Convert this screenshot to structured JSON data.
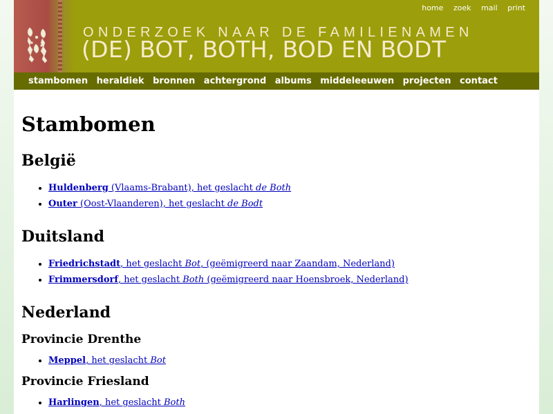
{
  "header": {
    "subtitle": "ONDERZOEK NAAR DE FAMILIENAMEN",
    "title": "(DE) BOT, BOTH, BOD EN BODT",
    "top_links": [
      "home",
      "zoek",
      "mail",
      "print"
    ]
  },
  "nav": {
    "items": [
      "stambomen",
      "heraldiek",
      "bronnen",
      "achtergrond",
      "albums",
      "middeleeuwen",
      "projecten",
      "contact"
    ]
  },
  "content": {
    "page_title": "Stambomen",
    "sections": [
      {
        "heading": "België",
        "entries": [
          {
            "place": "Huldenberg",
            "text": " (Vlaams-Brabant), het geslacht ",
            "name": "de Both",
            "suffix": ""
          },
          {
            "place": "Outer",
            "text": " (Oost-Vlaanderen), het geslacht ",
            "name": "de Bodt",
            "suffix": ""
          }
        ]
      },
      {
        "heading": "Duitsland",
        "entries": [
          {
            "place": "Friedrichstadt",
            "text": ", het geslacht ",
            "name": "Bot",
            "suffix": ", (geëmigreerd naar Zaandam, Nederland)"
          },
          {
            "place": "Frimmersdorf",
            "text": ", het geslacht ",
            "name": "Both",
            "suffix": " (geëmigreerd naar Hoensbroek, Nederland)"
          }
        ]
      },
      {
        "heading": "Nederland",
        "provinces": [
          {
            "heading": "Provincie Drenthe",
            "entries": [
              {
                "place": "Meppel",
                "text": ", het geslacht ",
                "name": "Bot",
                "suffix": ""
              }
            ]
          },
          {
            "heading": "Provincie Friesland",
            "entries": [
              {
                "place": "Harlingen",
                "text": ", het geslacht ",
                "name": "Both",
                "suffix": ""
              }
            ]
          }
        ]
      }
    ]
  },
  "colors": {
    "header_bg": "#9c9e0b",
    "nav_bg": "#676c00",
    "link": "#0000bb",
    "title_text": "#f6eccc"
  },
  "icons": [
    "heraldic-crest-icon"
  ]
}
